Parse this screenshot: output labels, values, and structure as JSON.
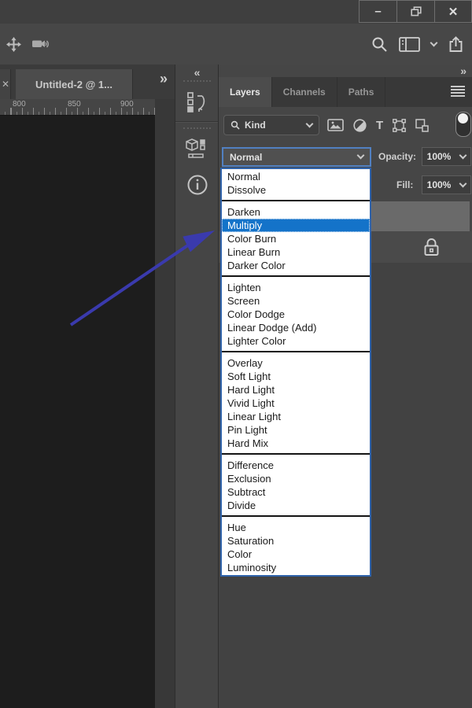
{
  "titlebar": {
    "minimize_glyph": "–",
    "close_glyph": "✕"
  },
  "document_tabs": {
    "partial_tab_close_glyph": "✕",
    "active_label": "Untitled-2 @ 1...",
    "overflow_glyph": "»"
  },
  "ruler": {
    "ticks": [
      "800",
      "850",
      "900"
    ]
  },
  "dock": {
    "collapse_glyph": "«"
  },
  "layers_panel": {
    "expand_glyph": "»",
    "tabs": [
      "Layers",
      "Channels",
      "Paths"
    ],
    "filter": {
      "kind_label": "Kind",
      "type_filter_glyph": "T"
    },
    "blend": {
      "value": "Normal"
    },
    "opacity": {
      "label": "Opacity:",
      "value": "100%"
    },
    "fill": {
      "label": "Fill:",
      "value": "100%"
    }
  },
  "blend_dropdown": {
    "selected": "Multiply",
    "highlight_color": "#1473c9",
    "border_color": "#3063aa",
    "groups": [
      [
        "Normal",
        "Dissolve"
      ],
      [
        "Darken",
        "Multiply",
        "Color Burn",
        "Linear Burn",
        "Darker Color"
      ],
      [
        "Lighten",
        "Screen",
        "Color Dodge",
        "Linear Dodge (Add)",
        "Lighter Color"
      ],
      [
        "Overlay",
        "Soft Light",
        "Hard Light",
        "Vivid Light",
        "Linear Light",
        "Pin Light",
        "Hard Mix"
      ],
      [
        "Difference",
        "Exclusion",
        "Subtract",
        "Divide"
      ],
      [
        "Hue",
        "Saturation",
        "Color",
        "Luminosity"
      ]
    ]
  },
  "annotation": {
    "arrow_color": "#3a3aad"
  }
}
